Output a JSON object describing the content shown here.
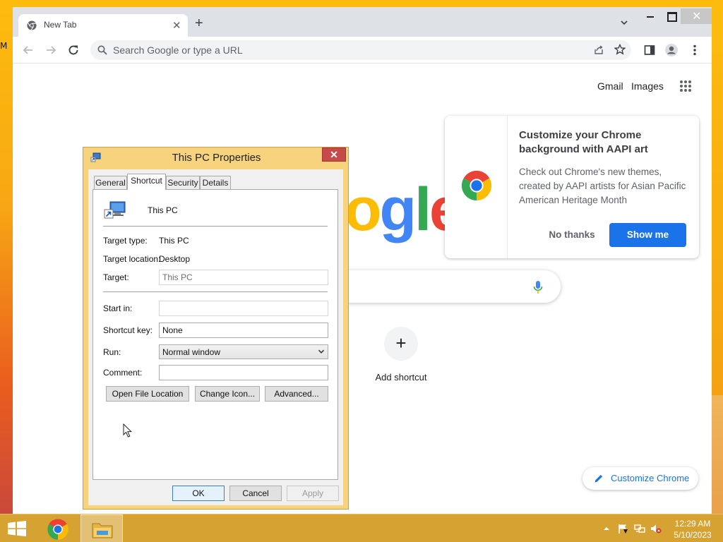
{
  "desktop": {
    "edge_text": "M"
  },
  "browser": {
    "tab_title": "New Tab",
    "omnibox_placeholder": "Search Google or type a URL",
    "header_links": {
      "gmail": "Gmail",
      "images": "Images"
    },
    "logo_letters": [
      "o",
      "g",
      "l",
      "e"
    ],
    "add_shortcut_label": "Add shortcut",
    "promo": {
      "title": "Customize your Chrome background with AAPI art",
      "body": "Check out Chrome's new themes, created by AAPI artists for Asian Pacific American Heritage Month",
      "dismiss_label": "No thanks",
      "accept_label": "Show me"
    },
    "customize_label": "Customize Chrome",
    "colors": {
      "accent": "#1a73e8",
      "frame": "#dee1e6",
      "omnibox": "#f1f3f4"
    }
  },
  "dialog": {
    "title": "This PC Properties",
    "tabs": [
      {
        "label": "General",
        "active": false
      },
      {
        "label": "Shortcut",
        "active": true
      },
      {
        "label": "Security",
        "active": false
      },
      {
        "label": "Details",
        "active": false
      }
    ],
    "shortcut_name": "This PC",
    "target_type": {
      "label": "Target type:",
      "value": "This PC"
    },
    "target_location": {
      "label": "Target location:",
      "value": "Desktop"
    },
    "target": {
      "label": "Target:",
      "value": "This PC"
    },
    "start_in": {
      "label": "Start in:",
      "value": ""
    },
    "shortcut_key": {
      "label": "Shortcut key:",
      "value": "None"
    },
    "run": {
      "label": "Run:",
      "value": "Normal window"
    },
    "comment": {
      "label": "Comment:",
      "value": ""
    },
    "buttons": {
      "open_file_location": "Open File Location",
      "change_icon": "Change Icon...",
      "advanced": "Advanced..."
    },
    "footer": {
      "ok": "OK",
      "cancel": "Cancel",
      "apply": "Apply"
    },
    "colors": {
      "frame": "#f6d37c",
      "close": "#c74a4a"
    }
  },
  "taskbar": {
    "time": "12:29 AM",
    "date": "5/10/2023",
    "color": "#d6a232"
  }
}
